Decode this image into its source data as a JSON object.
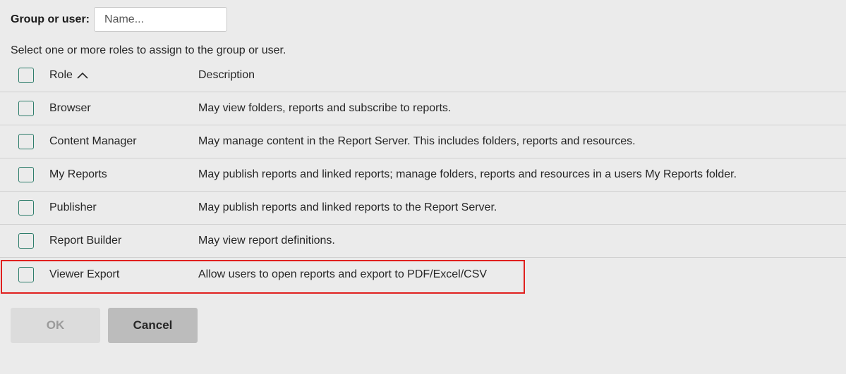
{
  "group": {
    "label": "Group or user:",
    "placeholder": "Name..."
  },
  "instructions": "Select one or more roles to assign to the group or user.",
  "table": {
    "headers": {
      "role": "Role",
      "description": "Description"
    },
    "rows": [
      {
        "role": "Browser",
        "description": "May view folders, reports and subscribe to reports."
      },
      {
        "role": "Content Manager",
        "description": "May manage content in the Report Server. This includes folders, reports and resources."
      },
      {
        "role": "My Reports",
        "description": "May publish reports and linked reports; manage folders, reports and resources in a users My Reports folder."
      },
      {
        "role": "Publisher",
        "description": "May publish reports and linked reports to the Report Server."
      },
      {
        "role": "Report Builder",
        "description": "May view report definitions."
      },
      {
        "role": "Viewer Export",
        "description": "Allow users to open reports and export to PDF/Excel/CSV"
      }
    ]
  },
  "buttons": {
    "ok": "OK",
    "cancel": "Cancel"
  },
  "colors": {
    "checkbox_border": "#2e7d6b",
    "highlight": "#e0201e",
    "background": "#ebebeb"
  },
  "icons": {
    "sort": "chevron-up-icon"
  }
}
